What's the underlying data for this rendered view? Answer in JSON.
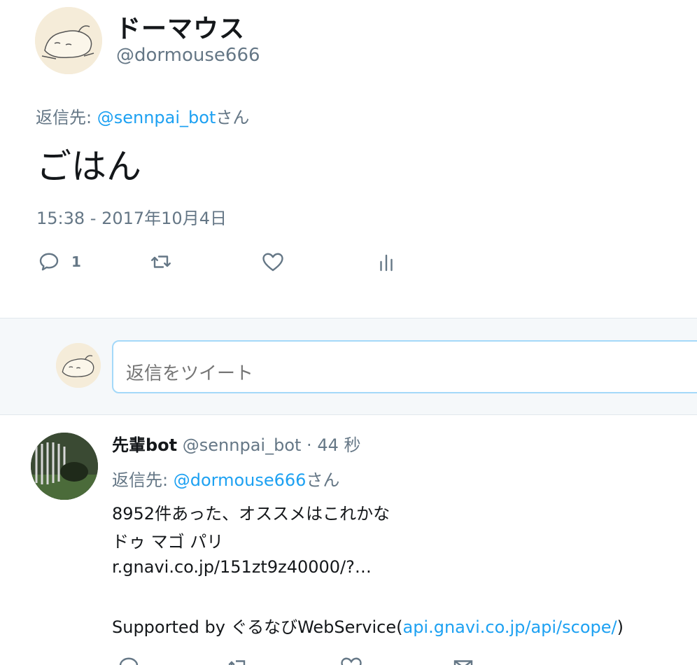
{
  "main_tweet": {
    "display_name": "ドーマウス",
    "handle": "@dormouse666",
    "reply_prefix": "返信先: ",
    "reply_to": "@sennpai_bot",
    "reply_suffix": "さん",
    "text": "ごはん",
    "timestamp": "15:38 - 2017年10月4日",
    "reply_count": "1"
  },
  "composer": {
    "placeholder": "返信をツイート"
  },
  "reply_tweet": {
    "display_name": "先輩bot",
    "handle": "@sennpai_bot",
    "separator": " · ",
    "time_ago": "44 秒",
    "reply_prefix": "返信先: ",
    "reply_to": "@dormouse666",
    "reply_suffix": "さん",
    "line1": "8952件あった、オススメはこれかな",
    "line2": "ドゥ マゴ パリ",
    "link1": "r.gnavi.co.jp/151zt9z40000/?…",
    "line4_prefix": "Supported by ぐるなびWebService(",
    "link2": "api.gnavi.co.jp/api/scope/",
    "line4_suffix": ")"
  },
  "colors": {
    "link": "#1da1f2",
    "muted": "#657786",
    "text": "#14171a",
    "composer_bg": "#f5f8fa",
    "input_border": "#a4d9f9"
  },
  "icons": [
    "reply-icon",
    "retweet-icon",
    "like-icon",
    "analytics-icon",
    "dm-icon"
  ]
}
